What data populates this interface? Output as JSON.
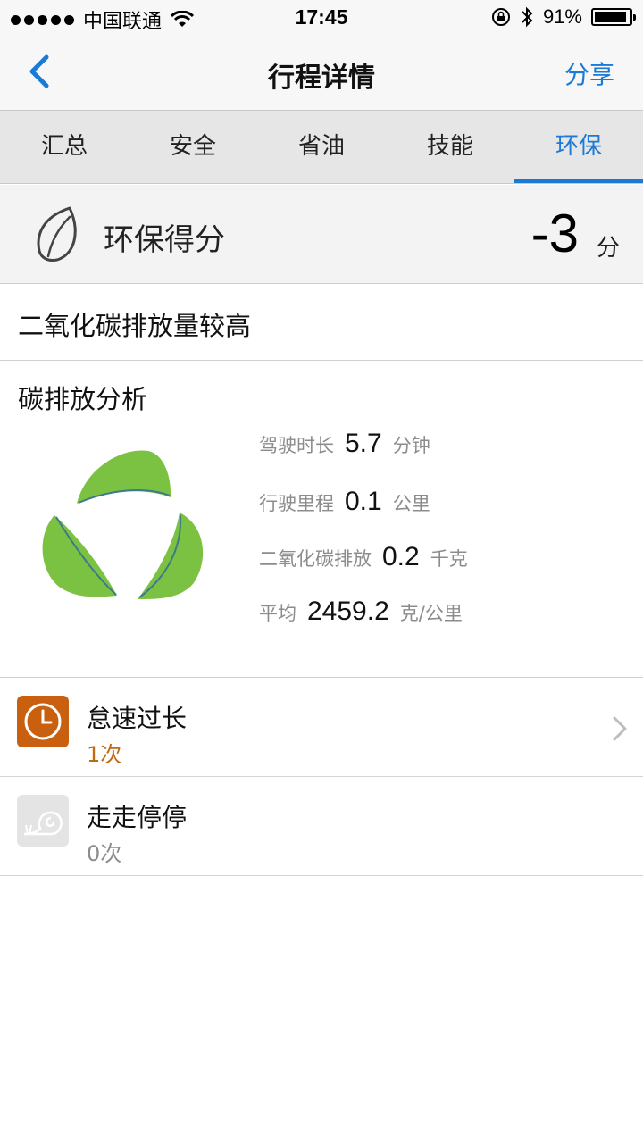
{
  "status_bar": {
    "carrier": "中国联通",
    "time": "17:45",
    "battery": "91%",
    "battery_level": 0.91
  },
  "nav": {
    "title": "行程详情",
    "share": "分享"
  },
  "tabs": [
    {
      "label": "汇总"
    },
    {
      "label": "安全"
    },
    {
      "label": "省油"
    },
    {
      "label": "技能"
    },
    {
      "label": "环保",
      "active": true
    }
  ],
  "score": {
    "label": "环保得分",
    "value": "-3",
    "unit": "分"
  },
  "summary": "二氧化碳排放量较高",
  "analysis": {
    "title": "碳排放分析",
    "stats": [
      {
        "label": "驾驶时长",
        "value": "5.7",
        "unit": "分钟"
      },
      {
        "label": "行驶里程",
        "value": "0.1",
        "unit": "公里"
      },
      {
        "label": "二氧化碳排放",
        "value": "0.2",
        "unit": "千克"
      },
      {
        "label": "平均",
        "value": "2459.2",
        "unit": "克/公里"
      }
    ]
  },
  "events": [
    {
      "title": "怠速过长",
      "count": "1次",
      "count_color": "#c36a10",
      "icon": "clock-icon",
      "icon_bg": "#c9600f"
    },
    {
      "title": "走走停停",
      "count": "0次",
      "count_color": "#8c8c8c",
      "icon": "snail-icon",
      "icon_bg": "#e4e4e4"
    }
  ],
  "colors": {
    "accent": "#1b7ad6",
    "leaf_green": "#7cc242"
  }
}
